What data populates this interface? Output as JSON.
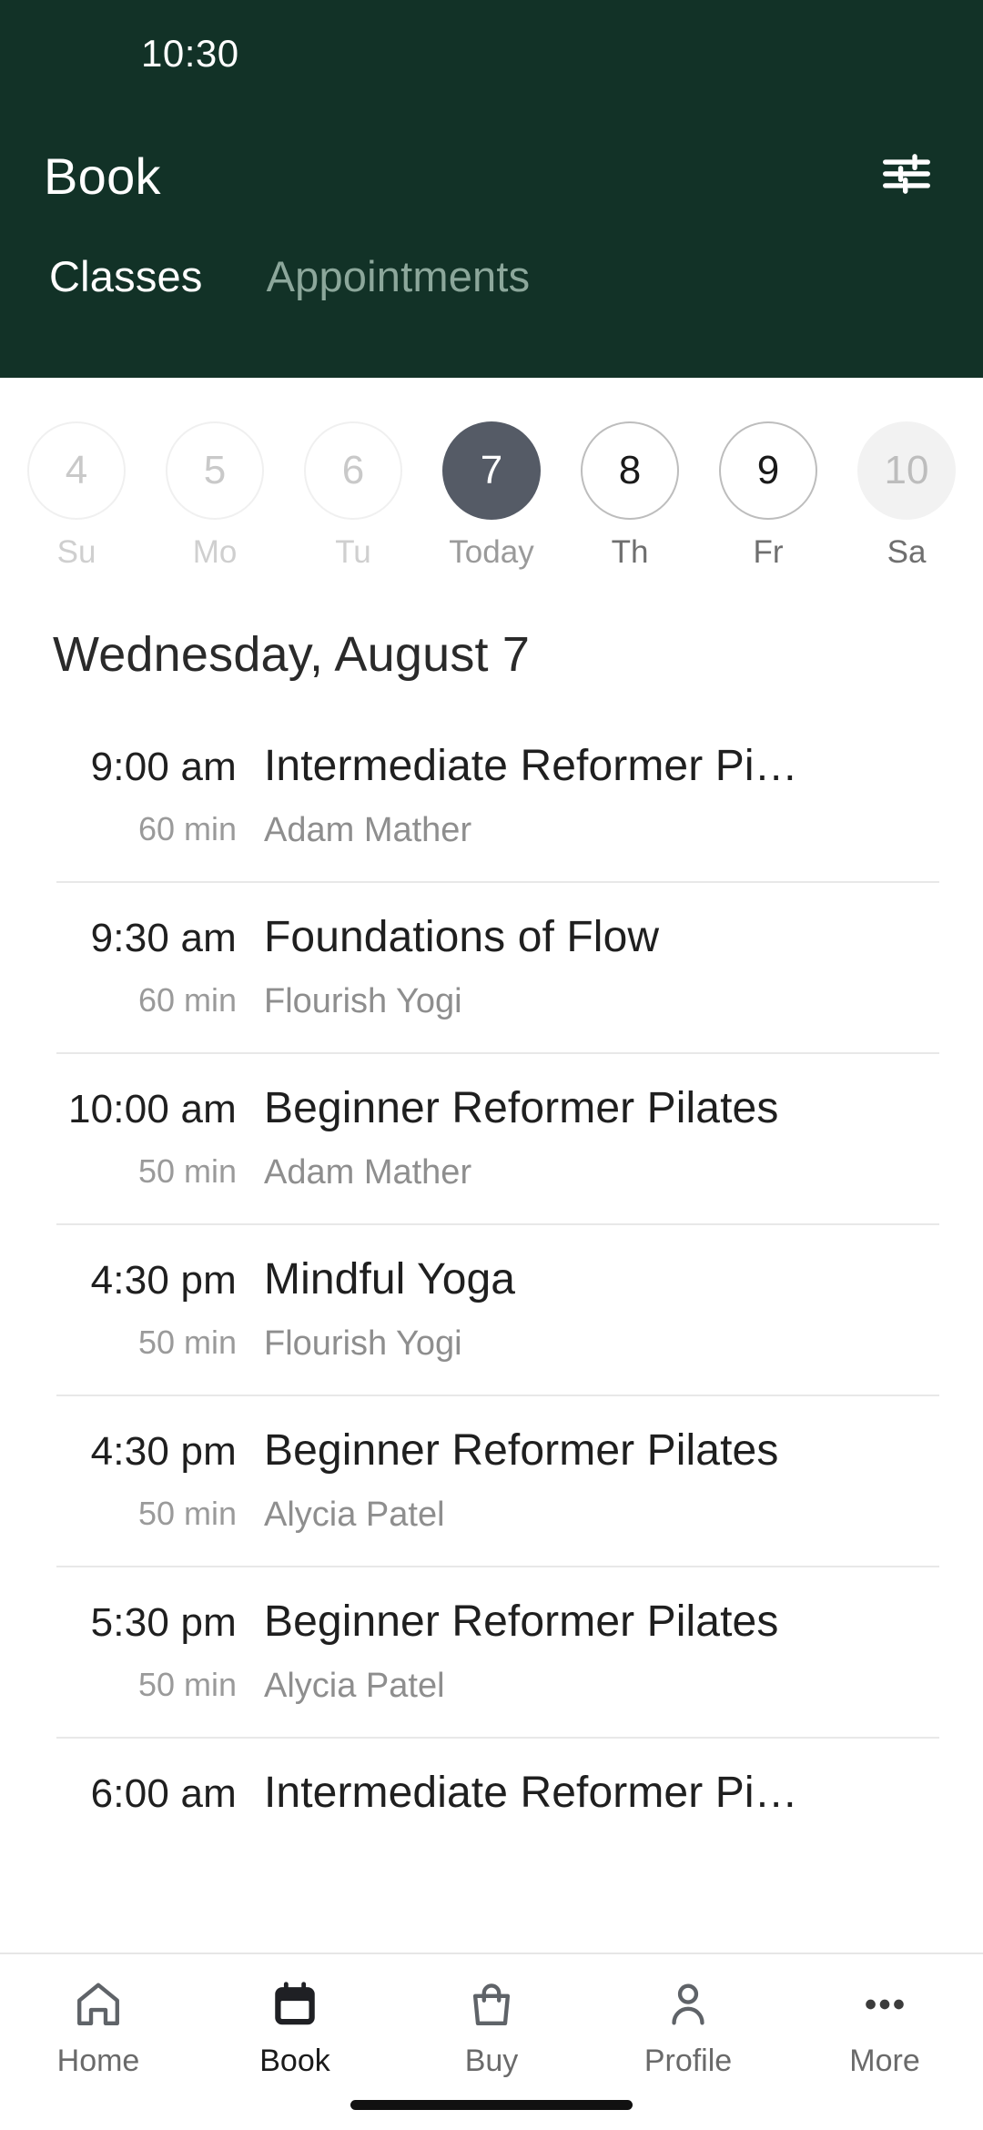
{
  "status_bar": {
    "time": "10:30"
  },
  "header": {
    "title": "Book",
    "filter_icon": "tune-sliders-icon",
    "background_color": "#123227",
    "tabs": [
      {
        "label": "Classes",
        "active": true
      },
      {
        "label": "Appointments",
        "active": false
      }
    ]
  },
  "date_strip": {
    "selected_color": "#555b66",
    "days": [
      {
        "number": "4",
        "weekday": "Su",
        "state": "disabled"
      },
      {
        "number": "5",
        "weekday": "Mo",
        "state": "disabled"
      },
      {
        "number": "6",
        "weekday": "Tu",
        "state": "disabled"
      },
      {
        "number": "7",
        "weekday": "Today",
        "state": "selected"
      },
      {
        "number": "8",
        "weekday": "Th",
        "state": "available"
      },
      {
        "number": "9",
        "weekday": "Fr",
        "state": "available"
      },
      {
        "number": "10",
        "weekday": "Sa",
        "state": "muted"
      }
    ]
  },
  "day_heading": "Wednesday, August 7",
  "classes": [
    {
      "time": "9:00 am",
      "duration": "60 min",
      "name": "Intermediate Reformer Pi…",
      "instructor": "Adam Mather"
    },
    {
      "time": "9:30 am",
      "duration": "60 min",
      "name": "Foundations of Flow",
      "instructor": "Flourish Yogi"
    },
    {
      "time": "10:00 am",
      "duration": "50 min",
      "name": "Beginner Reformer Pilates",
      "instructor": "Adam Mather"
    },
    {
      "time": "4:30 pm",
      "duration": "50 min",
      "name": "Mindful Yoga",
      "instructor": "Flourish Yogi"
    },
    {
      "time": "4:30 pm",
      "duration": "50 min",
      "name": "Beginner Reformer Pilates",
      "instructor": "Alycia Patel"
    },
    {
      "time": "5:30 pm",
      "duration": "50 min",
      "name": "Beginner Reformer Pilates",
      "instructor": "Alycia Patel"
    },
    {
      "time": "6:00 am",
      "duration": "",
      "name": "Intermediate Reformer Pi…",
      "instructor": ""
    }
  ],
  "bottom_nav": [
    {
      "label": "Home",
      "icon": "home-icon",
      "active": false
    },
    {
      "label": "Book",
      "icon": "calendar-icon",
      "active": true
    },
    {
      "label": "Buy",
      "icon": "shopping-bag-icon",
      "active": false
    },
    {
      "label": "Profile",
      "icon": "person-icon",
      "active": false
    },
    {
      "label": "More",
      "icon": "ellipsis-icon",
      "active": false
    }
  ]
}
